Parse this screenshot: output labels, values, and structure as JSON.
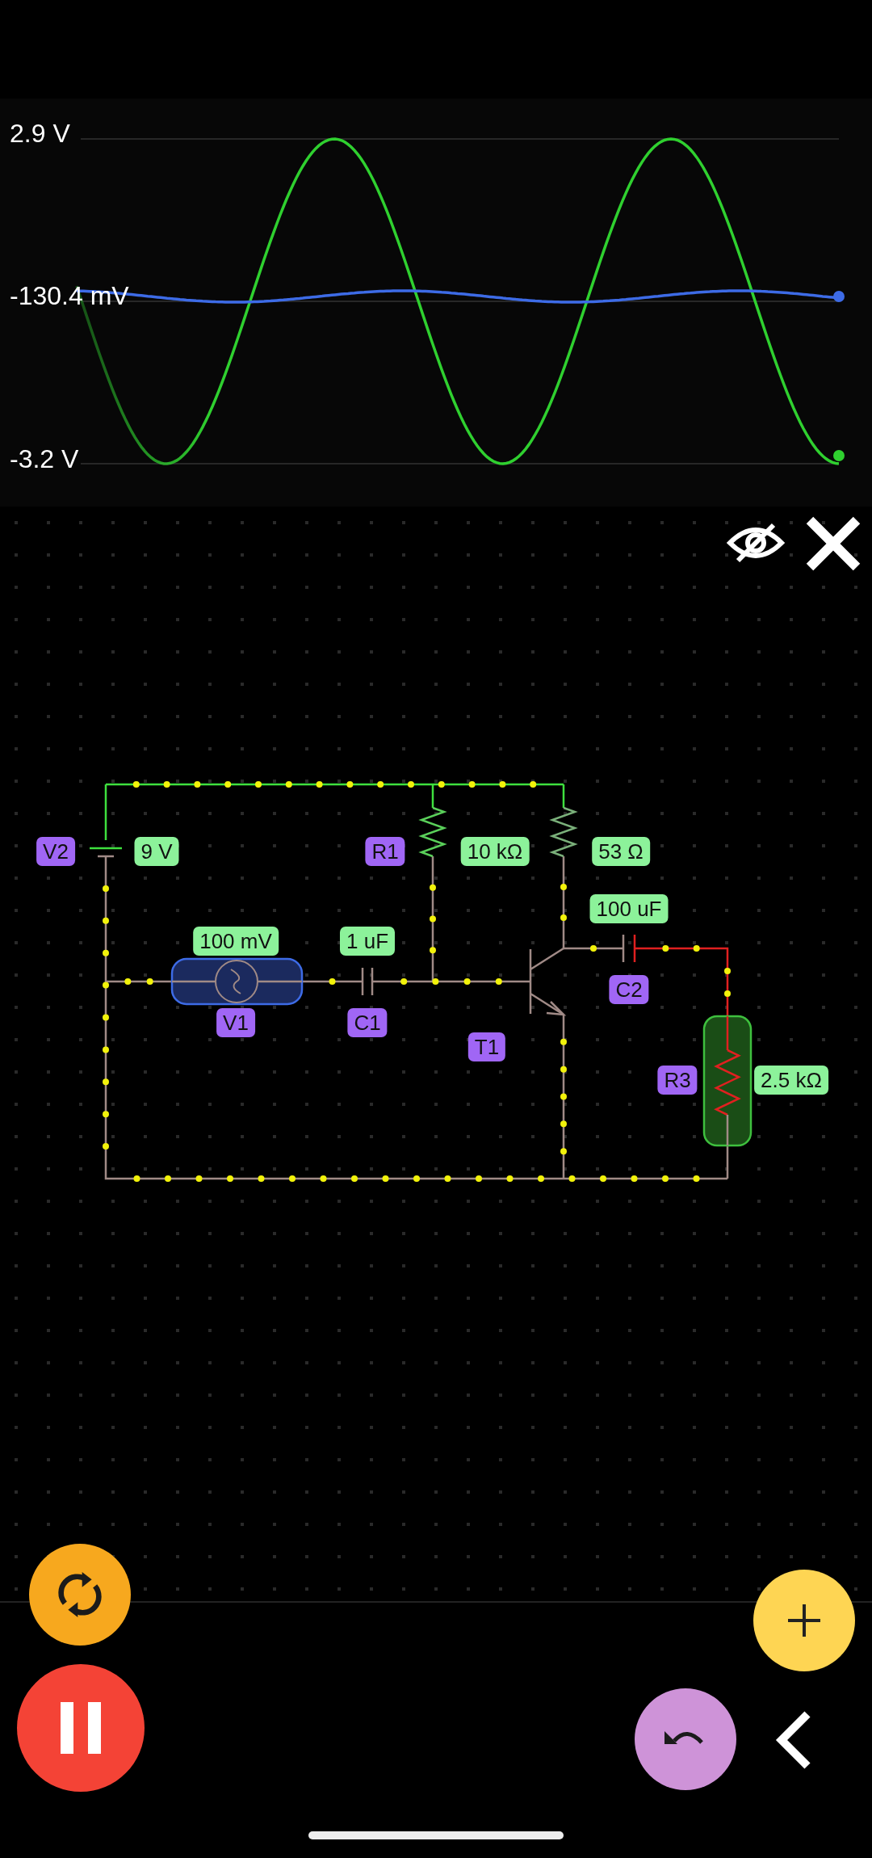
{
  "scope": {
    "labels": [
      "2.9 V",
      "-130.4 mV",
      "-3.2 V"
    ]
  },
  "circuit": {
    "tags": [
      {
        "kind": "name",
        "text": "V2"
      },
      {
        "kind": "value",
        "text": "9 V"
      },
      {
        "kind": "name",
        "text": "R1"
      },
      {
        "kind": "value",
        "text": "10 kΩ"
      },
      {
        "kind": "value",
        "text": "53 Ω"
      },
      {
        "kind": "value",
        "text": "100 uF"
      },
      {
        "kind": "value",
        "text": "100 mV"
      },
      {
        "kind": "value",
        "text": "1 uF"
      },
      {
        "kind": "name",
        "text": "V1"
      },
      {
        "kind": "name",
        "text": "C1"
      },
      {
        "kind": "name",
        "text": "C2"
      },
      {
        "kind": "name",
        "text": "T1"
      },
      {
        "kind": "name",
        "text": "R3"
      },
      {
        "kind": "value",
        "text": "2.5 kΩ"
      }
    ]
  }
}
